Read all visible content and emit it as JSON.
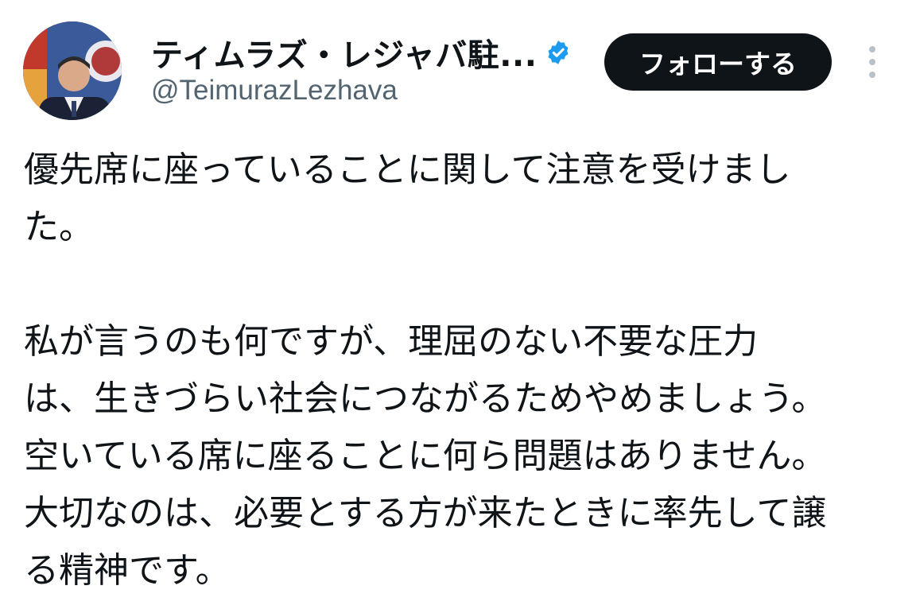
{
  "header": {
    "display_name": "ティムラズ・レジャバ駐...",
    "handle": "@TeimurazLezhava",
    "follow_label": "フォローする",
    "verified": true,
    "colors": {
      "verified_badge": "#1d9bf0",
      "follow_button_bg": "#0f1419",
      "handle_text": "#536471"
    }
  },
  "icons": {
    "avatar": "profile-photo",
    "verified": "verified-badge-icon",
    "more": "more-vertical-icon"
  },
  "tweet": {
    "paragraph1": {
      "line1": "優先席に座っていることに関して注意を受けまし",
      "line2": "た。"
    },
    "paragraph2": {
      "line1": "私が言うのも何ですが、理屈のない不要な圧力",
      "line2": "は、生きづらい社会につながるためやめましょう。",
      "line3": "空いている席に座ることに何ら問題はありません。",
      "line4": "大切なのは、必要とする方が来たときに率先して譲",
      "line5": "る精神です。"
    }
  }
}
